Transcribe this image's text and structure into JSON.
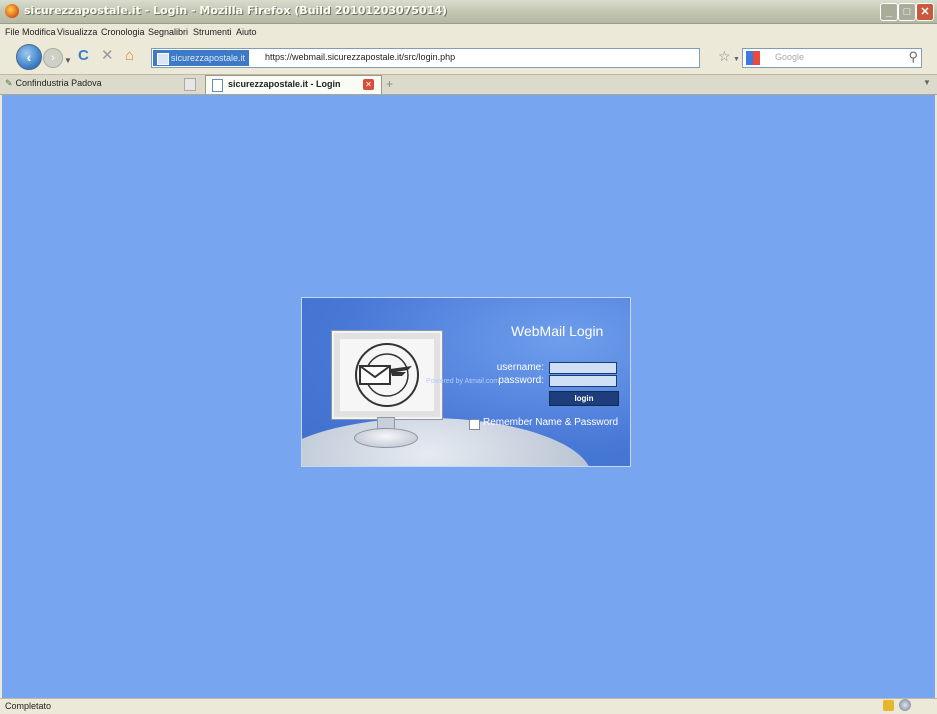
{
  "window": {
    "title": "sicurezzapostale.it - Login - Mozilla Firefox (Build 20101203075014)"
  },
  "menu": [
    "File",
    "Modifica",
    "Visualizza",
    "Cronologia",
    "Segnalibri",
    "Strumenti",
    "Aiuto"
  ],
  "navigation": {
    "site_identity": "sicurezzapostale.it",
    "url": "https://webmail.sicurezzapostale.it/src/login.php",
    "search_placeholder": "Google"
  },
  "bookmarks": {
    "item": "Confindustria Padova"
  },
  "tabs": [
    {
      "label": "",
      "active": false
    },
    {
      "label": "sicurezzapostale.it - Login",
      "active": true
    }
  ],
  "login": {
    "title": "WebMail Login",
    "username_label": "username:",
    "password_label": "password:",
    "username_value": "",
    "password_value": "",
    "login_button": "login",
    "remember_label": "Remember Name & Password",
    "remember_checked": false
  },
  "footer": {
    "powered": "Powered by Atmail.com"
  },
  "status": {
    "text": "Completato"
  },
  "colors": {
    "page_background": "#78a5ef",
    "panel": "#4878d6",
    "button": "#1d3e7a"
  },
  "icons": [
    "firefox-icon",
    "back-icon",
    "forward-icon",
    "reload-icon",
    "stop-icon",
    "home-icon",
    "star-icon",
    "search-icon",
    "lock-icon"
  ]
}
